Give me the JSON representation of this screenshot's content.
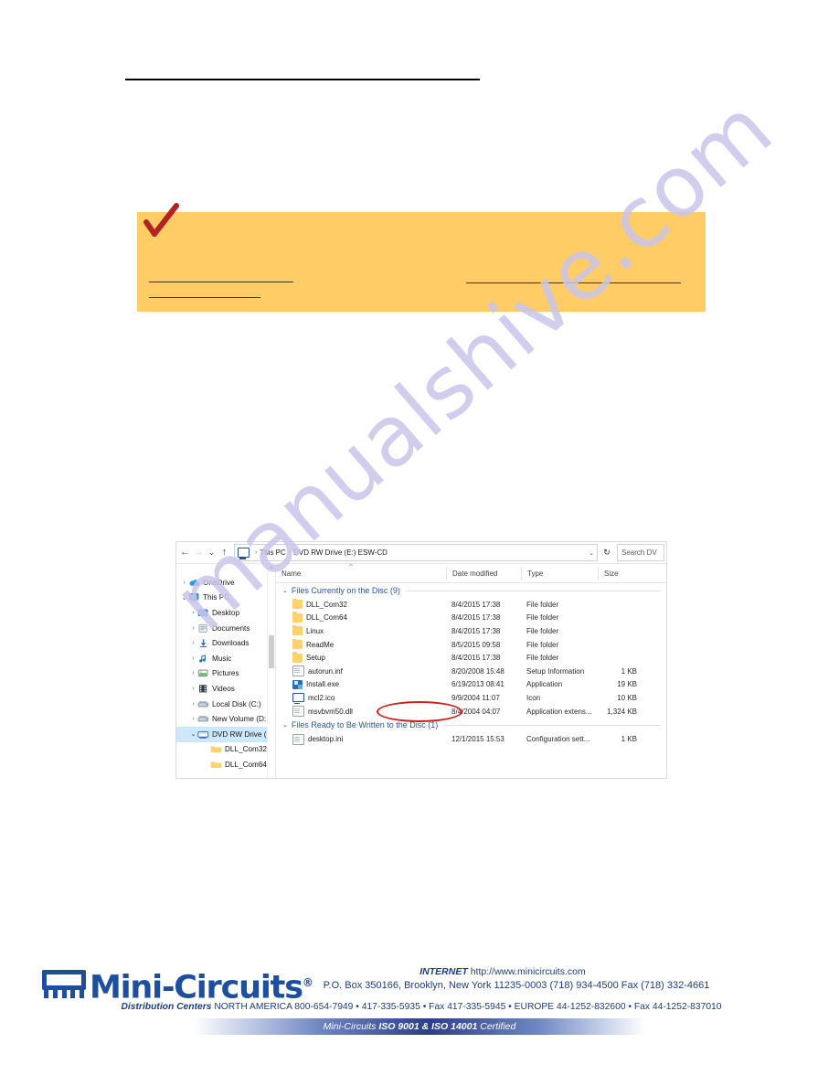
{
  "page": {
    "top_rule": true
  },
  "callout": {
    "background": "#ffcc66",
    "check_icon": "red-checkmark-icon",
    "blank_rules": 3
  },
  "explorer": {
    "address": {
      "back_icon": "back-arrow-icon",
      "forward_icon": "forward-arrow-icon",
      "recent_icon": "recent-locations-icon",
      "up_icon": "up-arrow-icon",
      "location_icon": "this-pc-icon",
      "crumbs": [
        "This PC",
        "DVD RW Drive (E:) ESW-CD"
      ],
      "separator": "›",
      "dropdown_icon": "chevron-down-icon",
      "refresh_icon": "refresh-icon",
      "search_placeholder": "Search DV"
    },
    "nav_pane": {
      "items": [
        {
          "label": "OneDrive",
          "indent": 1,
          "chevron": "›",
          "expanded": false,
          "icon": "onedrive-cloud-icon",
          "selected": false
        },
        {
          "label": "This PC",
          "indent": 1,
          "chevron": "⌄",
          "expanded": true,
          "icon": "this-pc-icon",
          "selected": false
        },
        {
          "label": "Desktop",
          "indent": 2,
          "chevron": "›",
          "expanded": false,
          "icon": "desktop-icon",
          "selected": false
        },
        {
          "label": "Documents",
          "indent": 2,
          "chevron": "›",
          "expanded": false,
          "icon": "documents-icon",
          "selected": false
        },
        {
          "label": "Downloads",
          "indent": 2,
          "chevron": "›",
          "expanded": false,
          "icon": "downloads-icon",
          "selected": false
        },
        {
          "label": "Music",
          "indent": 2,
          "chevron": "›",
          "expanded": false,
          "icon": "music-icon",
          "selected": false
        },
        {
          "label": "Pictures",
          "indent": 2,
          "chevron": "›",
          "expanded": false,
          "icon": "pictures-icon",
          "selected": false
        },
        {
          "label": "Videos",
          "indent": 2,
          "chevron": "›",
          "expanded": false,
          "icon": "videos-icon",
          "selected": false
        },
        {
          "label": "Local Disk (C:)",
          "indent": 2,
          "chevron": "›",
          "expanded": false,
          "icon": "hard-drive-icon",
          "selected": false
        },
        {
          "label": "New Volume (D:",
          "indent": 2,
          "chevron": "›",
          "expanded": false,
          "icon": "hard-drive-icon",
          "selected": false
        },
        {
          "label": "DVD RW Drive (E",
          "indent": 2,
          "chevron": "⌄",
          "expanded": true,
          "icon": "dvd-drive-icon",
          "selected": true
        },
        {
          "label": "DLL_Com32",
          "indent": 3,
          "chevron": "",
          "expanded": false,
          "icon": "folder-icon",
          "selected": false
        },
        {
          "label": "DLL_Com64",
          "indent": 3,
          "chevron": "",
          "expanded": false,
          "icon": "folder-icon",
          "selected": false
        }
      ],
      "scrollbar": "vertical-scrollbar"
    },
    "columns": [
      {
        "key": "name",
        "label": "Name"
      },
      {
        "key": "date",
        "label": "Date modified"
      },
      {
        "key": "type",
        "label": "Type"
      },
      {
        "key": "size",
        "label": "Size"
      }
    ],
    "sort_indicator": "˄",
    "groups": [
      {
        "title": "Files Currently on the Disc (9)",
        "chevron": "⌄",
        "rows": [
          {
            "name": "DLL_Com32",
            "date": "8/4/2015 17:38",
            "type": "File folder",
            "size": "",
            "icon": "folder-icon"
          },
          {
            "name": "DLL_Com64",
            "date": "8/4/2015 17:38",
            "type": "File folder",
            "size": "",
            "icon": "folder-icon"
          },
          {
            "name": "Linux",
            "date": "8/4/2015 17:38",
            "type": "File folder",
            "size": "",
            "icon": "folder-icon"
          },
          {
            "name": "ReadMe",
            "date": "8/5/2015 09:58",
            "type": "File folder",
            "size": "",
            "icon": "folder-icon"
          },
          {
            "name": "Setup",
            "date": "8/4/2015 17:38",
            "type": "File folder",
            "size": "",
            "icon": "folder-icon"
          },
          {
            "name": "autorun.inf",
            "date": "8/20/2008 15:48",
            "type": "Setup Information",
            "size": "1 KB",
            "icon": "inf-file-icon"
          },
          {
            "name": "Install.exe",
            "date": "6/19/2013 08:41",
            "type": "Application",
            "size": "19 KB",
            "icon": "application-icon"
          },
          {
            "name": "mcl2.ico",
            "date": "9/9/2004 11:07",
            "type": "Icon",
            "size": "10 KB",
            "icon": "icon-file-icon"
          },
          {
            "name": "msvbvm50.dll",
            "date": "8/4/2004 04:07",
            "type": "Application extens...",
            "size": "1,324 KB",
            "icon": "dll-file-icon"
          }
        ]
      },
      {
        "title": "Files Ready to Be Written to the Disc (1)",
        "chevron": "⌄",
        "rows": [
          {
            "name": "desktop.ini",
            "date": "12/1/2015 15:53",
            "type": "Configuration sett...",
            "size": "1 KB",
            "icon": "ini-file-icon"
          }
        ]
      }
    ],
    "annotation": {
      "shape": "red-ellipse",
      "color": "#cc1f1f",
      "targets": "Install.exe"
    }
  },
  "watermark": {
    "text": "manualshive.com",
    "color": "#c9c6ea"
  },
  "footer": {
    "logo_text": "Mini-Circuits",
    "logo_registered": "®",
    "logo_icon": "ic-chip-icon",
    "internet_label": "INTERNET",
    "website": "http://www.minicircuits.com",
    "address_line": "P.O. Box 350166, Brooklyn, New York 11235-0003 (718) 934-4500  Fax (718) 332-4661",
    "distribution_label": "Distribution Centers",
    "distribution_line": "NORTH AMERICA  800-654-7949  •  417-335-5935  •  Fax 417-335-5945 • EUROPE 44-1252-832600 • Fax 44-1252-837010",
    "iso_prefix": "Mini-Circuits ",
    "iso_bold": "ISO 9001 & ISO 14001",
    "iso_suffix": " Certified",
    "brand_color": "#1d4f9e"
  }
}
